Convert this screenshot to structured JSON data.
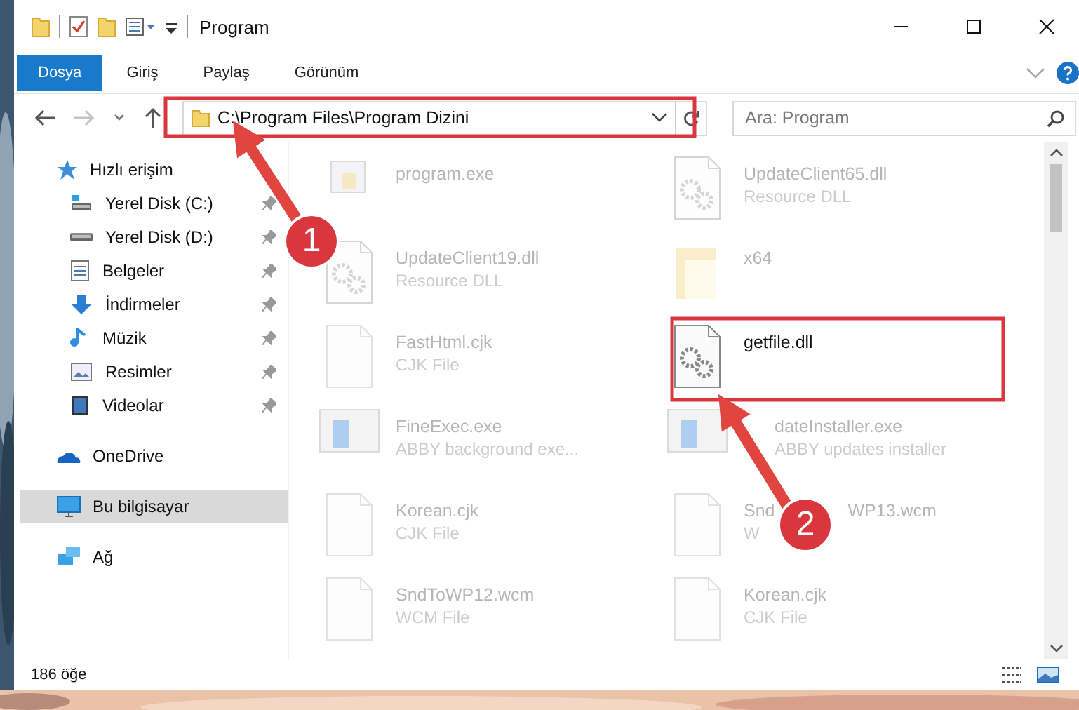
{
  "window": {
    "title": "Program"
  },
  "ribbon_tabs": [
    {
      "label": "Dosya",
      "selected": true
    },
    {
      "label": "Giriş",
      "selected": false
    },
    {
      "label": "Paylaş",
      "selected": false
    },
    {
      "label": "Görünüm",
      "selected": false
    }
  ],
  "address_bar": {
    "path": "C:\\Program Files\\Program Dizini",
    "highlighted": true
  },
  "search": {
    "placeholder": "Ara: Program"
  },
  "sidebar": {
    "items": [
      {
        "label": "Hızlı erişim",
        "kind": "star",
        "selected": false,
        "children": [
          {
            "label": "Yerel Disk (C:)",
            "kind": "disk-c",
            "selected": false,
            "pinned": true
          },
          {
            "label": "Yerel Disk (D:)",
            "kind": "disk",
            "selected": false,
            "pinned": true
          },
          {
            "label": "Belgeler",
            "kind": "docs",
            "selected": false,
            "pinned": true
          },
          {
            "label": "İndirmeler",
            "kind": "download",
            "selected": false,
            "pinned": true
          },
          {
            "label": "Müzik",
            "kind": "music",
            "selected": false,
            "pinned": true
          },
          {
            "label": "Resimler",
            "kind": "pictures",
            "selected": false,
            "pinned": true
          },
          {
            "label": "Videolar",
            "kind": "videos",
            "selected": false,
            "pinned": true
          }
        ]
      },
      {
        "label": "OneDrive",
        "kind": "cloud",
        "selected": false
      },
      {
        "label": "Bu bilgisayar",
        "kind": "pc",
        "selected": true
      },
      {
        "label": "Ağ",
        "kind": "network",
        "selected": false
      }
    ]
  },
  "files": [
    {
      "name": "program.exe",
      "kind": "app",
      "faded": true,
      "highlighted": false
    },
    {
      "name": "UpdateClient65.dll",
      "type": "Resource DLL",
      "kind": "dll",
      "faded": true,
      "highlighted": false
    },
    {
      "name": "UpdateClient19.dll",
      "type": "Resource DLL",
      "kind": "dll",
      "faded": true,
      "highlighted": false
    },
    {
      "name": "x64",
      "kind": "folder",
      "faded": true,
      "highlighted": false
    },
    {
      "name": "FastHtml.cjk",
      "type": "CJK File",
      "kind": "document",
      "faded": true,
      "highlighted": false
    },
    {
      "name": "getfile.dll",
      "kind": "dll",
      "faded": false,
      "highlighted": true
    },
    {
      "name": "FineExec.exe",
      "type": "ABBY background exe...",
      "kind": "exe",
      "faded": true,
      "highlighted": false
    },
    {
      "name": "dateInstaller.exe",
      "type": "ABBY updates installer",
      "kind": "exe",
      "faded": true,
      "highlighted": false,
      "behind_arrow": true
    },
    {
      "name": "Korean.cjk",
      "type": "CJK File",
      "kind": "document",
      "faded": true,
      "highlighted": false
    },
    {
      "name": "Snd",
      "name_tail": "WP13.wcm",
      "type": "W",
      "kind": "document",
      "faded": true,
      "highlighted": false
    },
    {
      "name": "SndToWP12.wcm",
      "type": "WCM File",
      "kind": "document",
      "faded": true,
      "highlighted": false
    },
    {
      "name": "Korean.cjk",
      "type": "CJK File",
      "kind": "document",
      "faded": true,
      "highlighted": false
    }
  ],
  "status_bar": {
    "count": "186 öğe"
  },
  "annotations": [
    {
      "label": "1"
    },
    {
      "label": "2"
    }
  ]
}
